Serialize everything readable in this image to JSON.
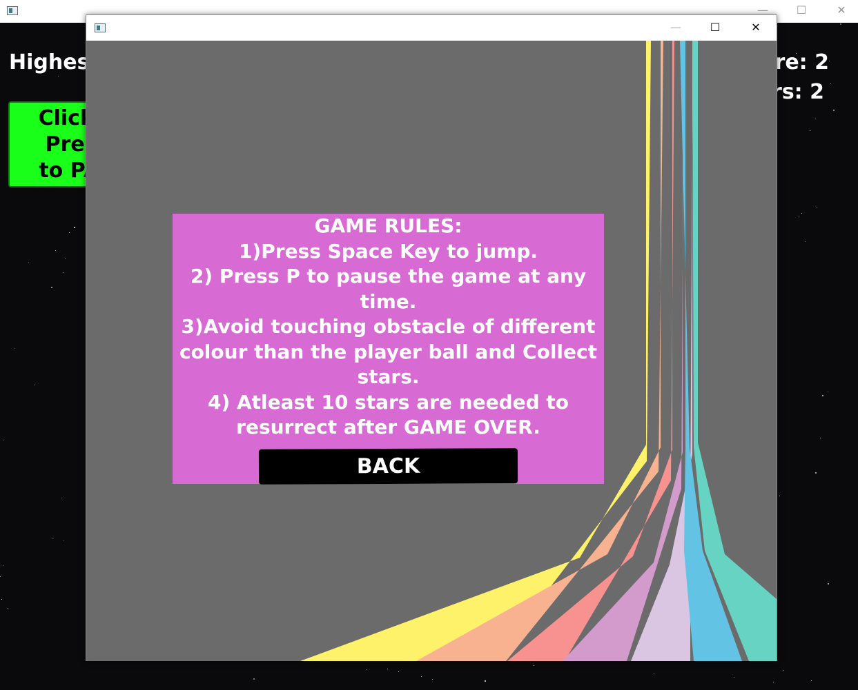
{
  "background_window": {
    "highest_label": "Highes",
    "score_label": "re: 2",
    "stars_label": "rs: 2",
    "green_button": {
      "line1": "Click C",
      "line2": "Press",
      "line3": "to PAU"
    },
    "controls": {
      "minimize": "—",
      "maximize": "☐",
      "close": "✕"
    }
  },
  "foreground_window": {
    "controls": {
      "minimize": "—",
      "maximize": "☐",
      "close": "✕"
    },
    "rules_text": "GAME RULES:\n1)Press Space Key to jump.\n2) Press P to pause the game at any time.\n3)Avoid touching obstacle of different colour than the player ball and Collect stars.\n4) Atleast 10 stars are needed to resurrect after GAME OVER.",
    "back_button_label": "BACK"
  },
  "colors": {
    "canvas_gray": "#6b6b6b",
    "panel_pink": "#d86ad4",
    "green_button": "#1aff1a",
    "stripes": [
      "#fff26b",
      "#f9b28f",
      "#f79290",
      "#d39bcc",
      "#dac6e2",
      "#62c3e5",
      "#66d3c3"
    ]
  },
  "icons": {
    "app": "window-app-icon",
    "minimize": "minimize-icon",
    "maximize": "maximize-icon",
    "close": "close-icon"
  }
}
